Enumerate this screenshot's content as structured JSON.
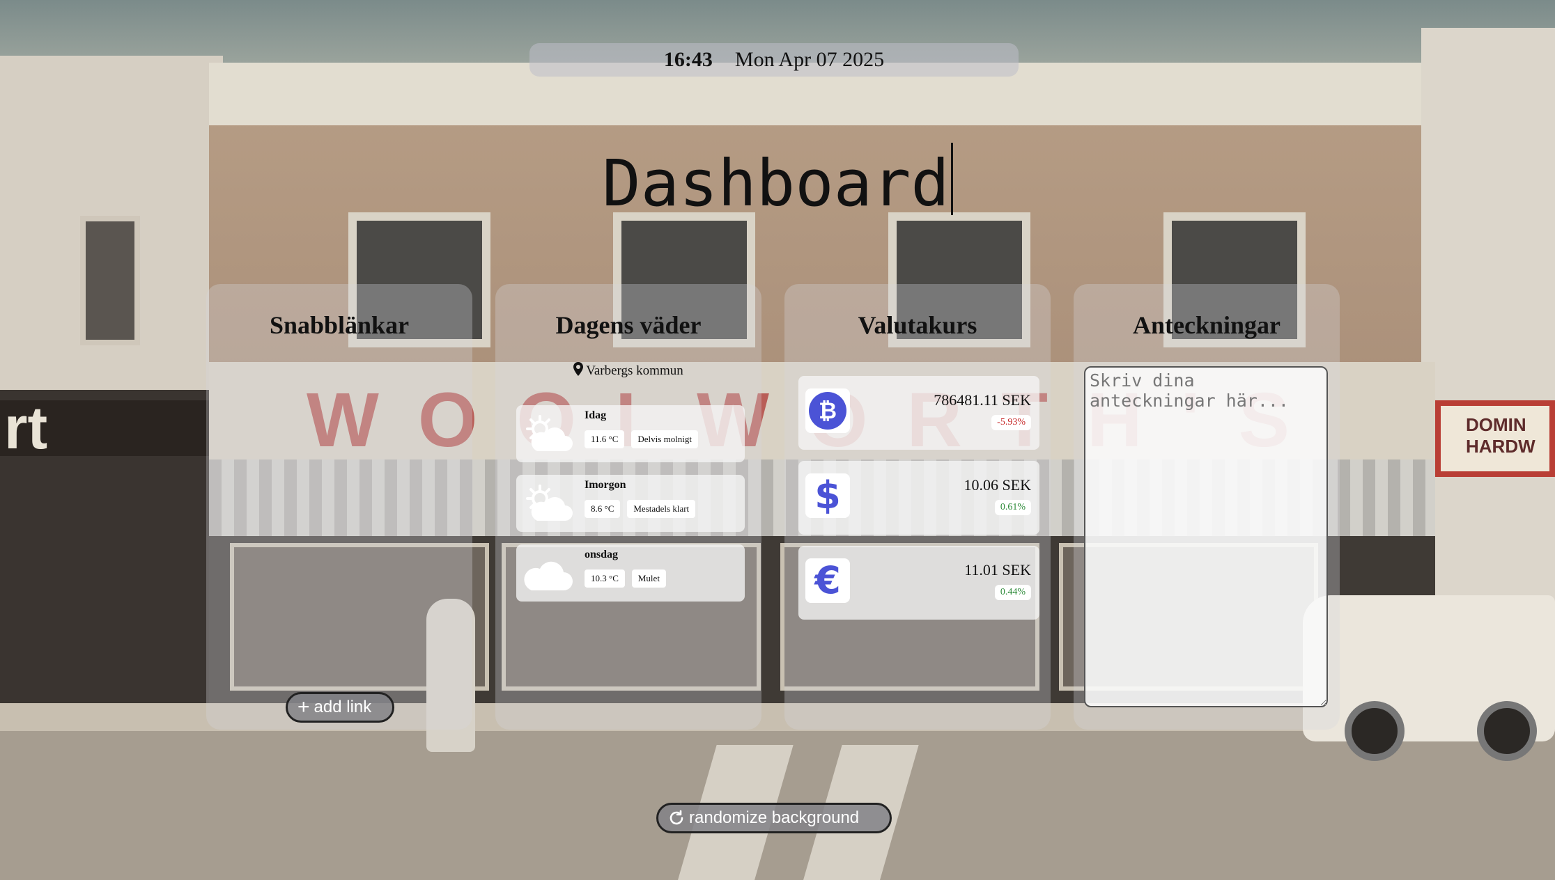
{
  "header": {
    "time": "16:43",
    "date": "Mon Apr 07 2025"
  },
  "title": "Dashboard",
  "quick_links": {
    "heading": "Snabblänkar",
    "add_label": "add link"
  },
  "weather": {
    "heading": "Dagens väder",
    "location": "Varbergs kommun",
    "days": [
      {
        "day": "Idag",
        "temp": "11.6 °C",
        "desc": "Delvis molnigt",
        "icon": "partly-cloudy-icon"
      },
      {
        "day": "Imorgon",
        "temp": "8.6 °C",
        "desc": "Mestadels klart",
        "icon": "partly-cloudy-icon"
      },
      {
        "day": "onsdag",
        "temp": "10.3 °C",
        "desc": "Mulet",
        "icon": "cloud-icon"
      }
    ]
  },
  "currency": {
    "heading": "Valutakurs",
    "accent": "#4b53d6",
    "rates": [
      {
        "icon": "bitcoin-icon",
        "price": "786481.11 SEK",
        "change": "-5.93%"
      },
      {
        "icon": "dollar-icon",
        "price": "10.06 SEK",
        "change": "0.61%"
      },
      {
        "icon": "euro-icon",
        "price": "11.01 SEK",
        "change": "0.44%"
      }
    ]
  },
  "notes": {
    "heading": "Anteckningar",
    "placeholder": "Skriv dina anteckningar här..."
  },
  "footer": {
    "randomize_label": "randomize background"
  }
}
